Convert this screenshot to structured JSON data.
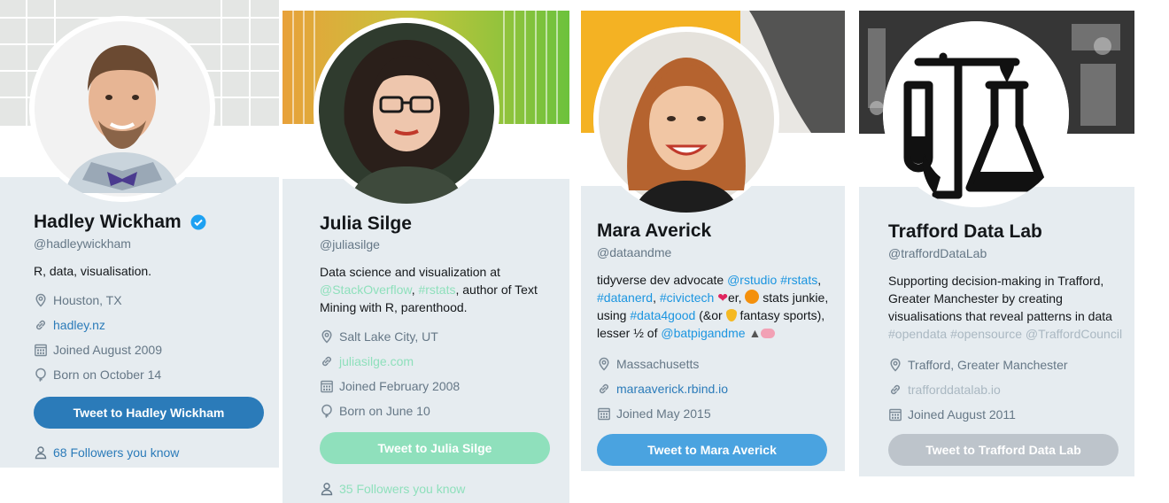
{
  "cards": [
    {
      "name": "Hadley Wickham",
      "handle": "@hadleywickham",
      "bio": "R, data, visualisation.",
      "location": "Houston, TX",
      "website": "hadley.nz",
      "joined": "Joined August 2009",
      "born": "Born on October 14",
      "tweet_button": "Tweet to Hadley Wickham",
      "followers_you_know": "68 Followers you know",
      "accent_color": "#2b7bb9",
      "verified": true
    },
    {
      "name": "Julia Silge",
      "handle": "@juliasilge",
      "bio_line1_prefix": "Data science and visualization at",
      "bio_mention": "@StackOverflow",
      "bio_sep": ", ",
      "bio_hashtag": "#rstats",
      "bio_rest": ", author of Text Mining with R, parenthood.",
      "location": "Salt Lake City, UT",
      "website": "juliasilge.com",
      "joined": "Joined February 2008",
      "born": "Born on June 10",
      "tweet_button": "Tweet to Julia Silge",
      "followers_you_know": "35 Followers you know",
      "accent_color": "#8fe0bc"
    },
    {
      "name": "Mara Averick",
      "handle": "@dataandme",
      "bio_p1": "tidyverse dev advocate ",
      "bio_m1": "@rstudio",
      "bio_sp1": " ",
      "bio_h1": "#rstats",
      "bio_sp2": ",",
      "bio_h2": "#datanerd",
      "bio_sp3": ", ",
      "bio_h3": "#civictech",
      "bio_p2": "er,",
      "bio_p3": " stats junkie, using ",
      "bio_h4": "#data4good",
      "bio_p4": " (&or ",
      "bio_p5": " fantasy sports), lesser ½ of ",
      "bio_m2": "@batpigandme",
      "location": "Massachusetts",
      "website": "maraaverick.rbind.io",
      "joined": "Joined May 2015",
      "tweet_button": "Tweet to Mara Averick",
      "accent_color": "#4aa3e0"
    },
    {
      "name": "Trafford Data Lab",
      "handle": "@traffordDataLab",
      "bio": "Supporting decision-making in Trafford, Greater Manchester by creating visualisations that reveal patterns in data",
      "bio_tags": "#opendata #opensource @TraffordCouncil",
      "location": "Trafford, Greater Manchester",
      "website": "trafforddatalab.io",
      "joined": "Joined August 2011",
      "tweet_button": "Tweet to Trafford Data Lab",
      "accent_color": "#bdc4cb"
    }
  ],
  "icons": {
    "location": "location-pin-icon",
    "link": "link-icon",
    "calendar": "calendar-icon",
    "born": "balloon-icon",
    "person": "person-icon",
    "verified": "verified-badge-icon"
  }
}
